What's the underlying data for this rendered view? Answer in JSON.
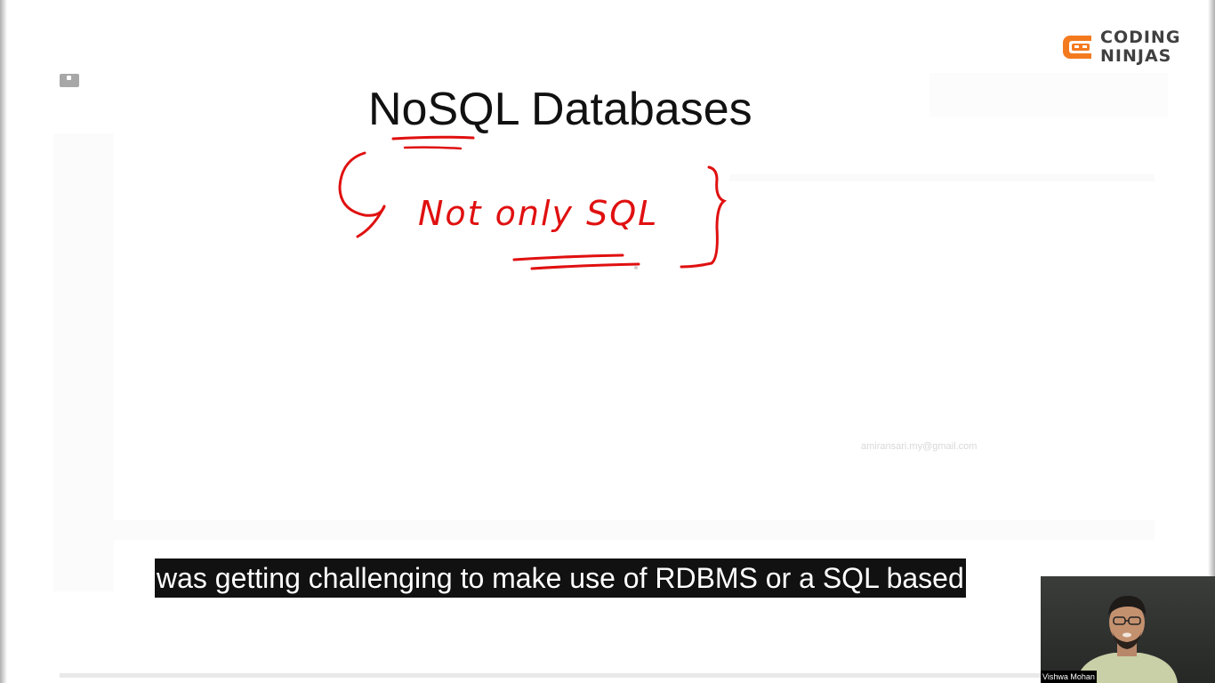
{
  "slide": {
    "title": "NoSQL Databases",
    "annotation_text": "Not only SQL"
  },
  "brand": {
    "line1": "CODING",
    "line2": "NINJAS",
    "icon": "coding-ninjas-logo-icon",
    "accent_color": "#f47a20"
  },
  "watermark": {
    "email": "amiransari.my@gmail.com"
  },
  "caption": {
    "text": "was getting challenging to make use of RDBMS or a SQL based"
  },
  "presenter": {
    "name": "Vishwa Mohan"
  },
  "colors": {
    "ink": "#e01010",
    "background": "#ffffff",
    "caption_bg": "#111111"
  }
}
